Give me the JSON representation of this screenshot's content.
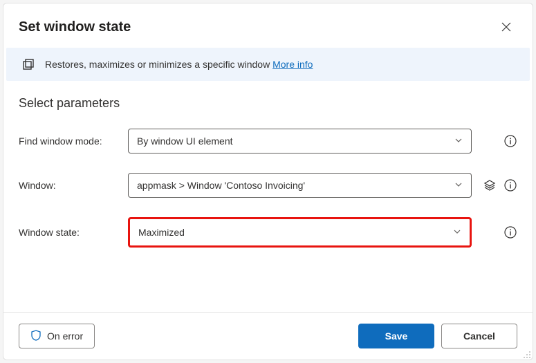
{
  "header": {
    "title": "Set window state"
  },
  "banner": {
    "text": "Restores, maximizes or minimizes a specific window",
    "link": "More info"
  },
  "section": {
    "title": "Select parameters"
  },
  "params": {
    "find_mode": {
      "label": "Find window mode:",
      "value": "By window UI element"
    },
    "window": {
      "label": "Window:",
      "value": "appmask > Window 'Contoso Invoicing'"
    },
    "state": {
      "label": "Window state:",
      "value": "Maximized"
    }
  },
  "footer": {
    "on_error": "On error",
    "save": "Save",
    "cancel": "Cancel"
  }
}
